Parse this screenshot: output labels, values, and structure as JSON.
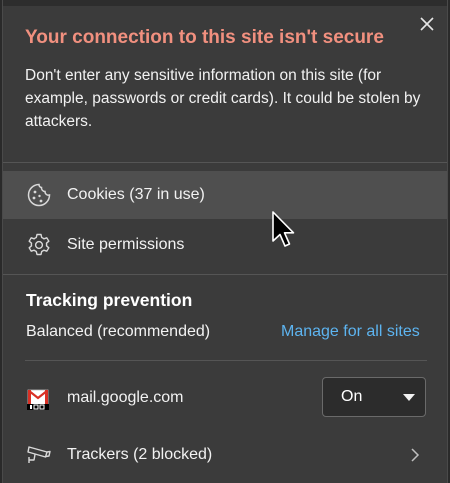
{
  "warning": {
    "title": "Your connection to this site isn't secure",
    "description": "Don't enter any sensitive information on this site (for example, passwords or credit cards). It could be stolen by attackers."
  },
  "close": {
    "icon": "close-icon"
  },
  "rows": {
    "cookies": {
      "label": "Cookies (37 in use)",
      "icon": "cookie-icon"
    },
    "permissions": {
      "label": "Site permissions",
      "icon": "gear-icon"
    }
  },
  "tracking": {
    "title": "Tracking prevention",
    "level": "Balanced (recommended)",
    "manage_link": "Manage for all sites",
    "site": {
      "domain": "mail.google.com",
      "favicon": "gmail-icon",
      "toggle_value": "On"
    },
    "trackers": {
      "label": "Trackers (2 blocked)",
      "icon": "tracker-camera-icon"
    }
  },
  "colors": {
    "warning": "#f1907f",
    "link": "#5db4f0",
    "panel_bg": "#3b3b3b",
    "highlight_bg": "#4f4f4f"
  }
}
